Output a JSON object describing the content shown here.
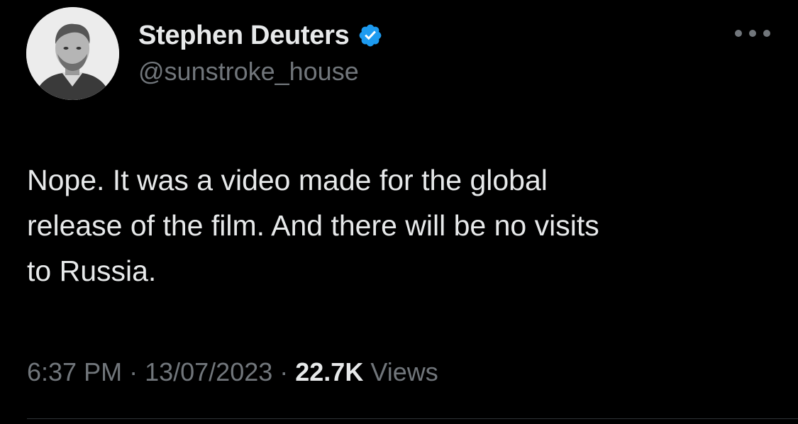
{
  "author": {
    "display_name": "Stephen Deuters",
    "handle": "@sunstroke_house",
    "verified": true,
    "avatar_icon": "grayscale-portrait-avatar"
  },
  "tweet": {
    "text": "Nope. It was a video made for the global\nrelease of the film. And there will be no visits\nto Russia."
  },
  "meta": {
    "time": "6:37 PM",
    "separator": "·",
    "date": "13/07/2023",
    "views_count": "22.7K",
    "views_label": "Views"
  },
  "icons": {
    "verified": "verified-badge-icon",
    "more": "more-options-icon"
  },
  "colors": {
    "background": "#000000",
    "primary_text": "#e7e9ea",
    "secondary_text": "#71767b",
    "verified_blue": "#1d9bf0",
    "divider": "#2f3336"
  }
}
